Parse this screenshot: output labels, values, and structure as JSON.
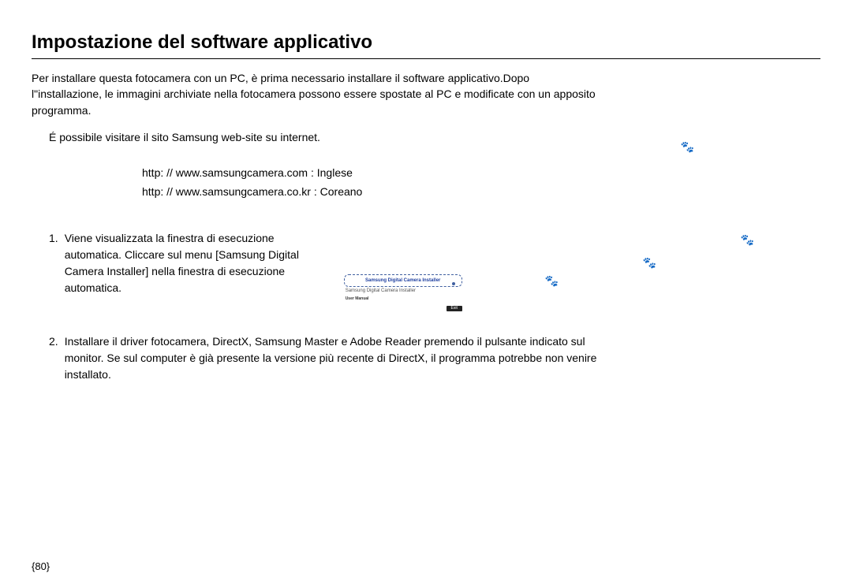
{
  "title": "Impostazione del software applicativo",
  "intro": "Per installare questa fotocamera con un PC, è prima necessario installare il software applicativo.Dopo l\"installazione, le immagini archiviate nella fotocamera possono essere spostate al PC e modificate con un apposito programma.",
  "website_note": "É possibile visitare il sito Samsung  web-site su internet.",
  "urls": {
    "line1": "http: //  www.samsungcamera.com  :  Inglese",
    "line2": "http: //  www.samsungcamera.co.kr  :  Coreano"
  },
  "step1": {
    "number": "1.",
    "text": "Viene visualizzata la finestra di esecuzione automatica.  Cliccare sul menu [Samsung Digital Camera Installer] nella finestra di esecuzione automatica."
  },
  "autorun": {
    "installer": "Samsung Digital Camera Installer",
    "installer_sub": "Samsung Digital Camera Installer",
    "user_manual": "User Manual",
    "exit": "Exit"
  },
  "step2": {
    "number": "2.",
    "text": "Installare il driver fotocamera, DirectX, Samsung Master e Adobe Reader premendo il pulsante indicato sul monitor.  Se sul computer è già presente la versione più recente di DirectX, il programma potrebbe non venire installato."
  },
  "page_number": "{80}"
}
